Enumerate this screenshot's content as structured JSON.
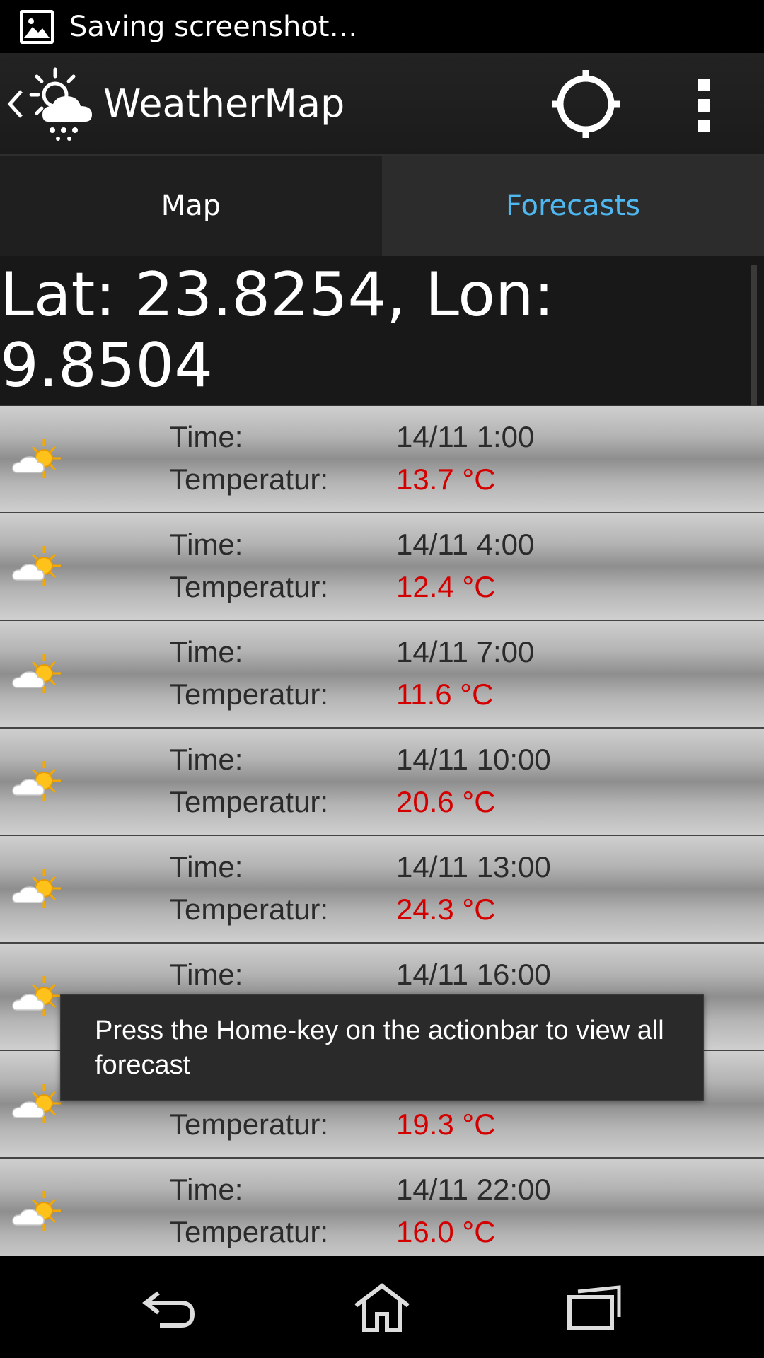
{
  "status_bar": {
    "text": "Saving screenshot…"
  },
  "action_bar": {
    "title": "WeatherMap"
  },
  "tabs": [
    {
      "label": "Map",
      "selected": false
    },
    {
      "label": "Forecasts",
      "selected": true
    }
  ],
  "location": {
    "text": "Lat: 23.8254, Lon: 9.8504"
  },
  "forecast": {
    "time_label": "Time:",
    "temp_label": "Temperatur:",
    "rows": [
      {
        "icon": "partly-sunny-icon",
        "time": "14/11 1:00",
        "temp": "13.7 °C"
      },
      {
        "icon": "partly-sunny-icon",
        "time": "14/11 4:00",
        "temp": "12.4 °C"
      },
      {
        "icon": "partly-sunny-icon",
        "time": "14/11 7:00",
        "temp": "11.6 °C"
      },
      {
        "icon": "partly-sunny-icon",
        "time": "14/11 10:00",
        "temp": "20.6 °C"
      },
      {
        "icon": "partly-sunny-icon",
        "time": "14/11 13:00",
        "temp": "24.3 °C"
      },
      {
        "icon": "partly-sunny-icon",
        "time": "14/11 16:00",
        "temp": ""
      },
      {
        "icon": "partly-sunny-icon",
        "time": "",
        "temp": "19.3 °C"
      },
      {
        "icon": "partly-sunny-icon",
        "time": "14/11 22:00",
        "temp": "16.0 °C"
      }
    ]
  },
  "toast": {
    "message": "Press the Home-key on the actionbar to view all forecast"
  },
  "colors": {
    "accent": "#4fb8f0",
    "temperature": "#d40000"
  }
}
